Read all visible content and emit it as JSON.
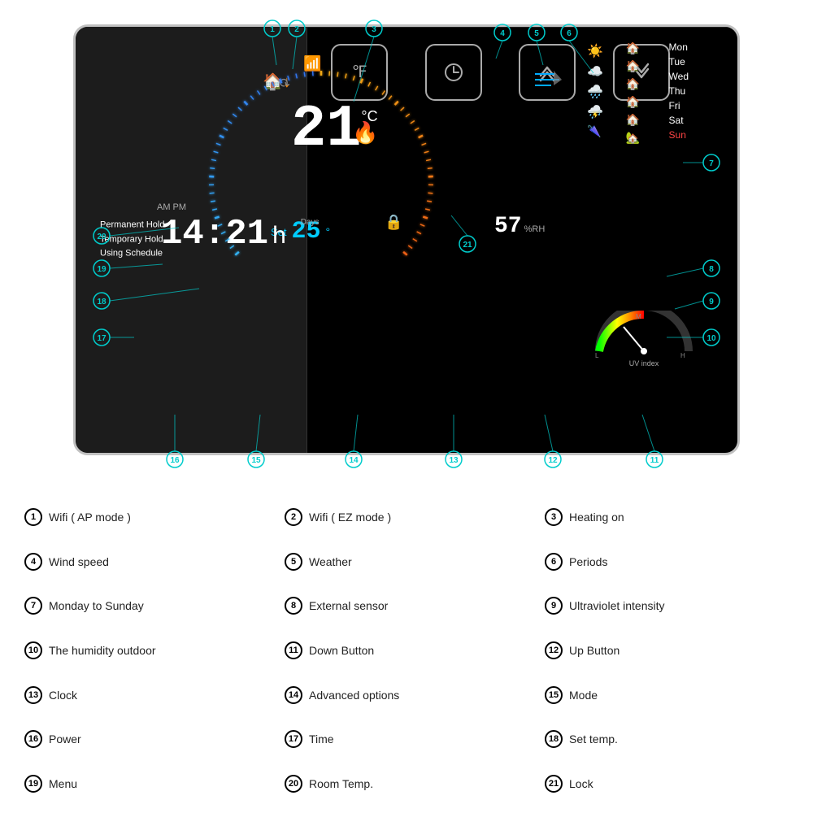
{
  "device": {
    "current_temp": "21",
    "temp_unit": "°C",
    "set_label": "Set",
    "set_temp": "25",
    "set_unit": "°",
    "time": "14:21",
    "time_suffix": "h",
    "am_pm": "AM PM",
    "days_label": "Days",
    "humidity": "57",
    "humidity_unit": "%RH",
    "uv_label": "UV index",
    "hold_modes": [
      "Permanent Hold",
      "Temporary Hold",
      "Using Schedule"
    ]
  },
  "days": [
    "Mon",
    "Tue",
    "Wed",
    "Thu",
    "Fri",
    "Sat",
    "Sun"
  ],
  "buttons": [
    {
      "id": "power",
      "symbol": "⏻",
      "label": "Power"
    },
    {
      "id": "mode",
      "symbol": "⊞",
      "label": "Mode"
    },
    {
      "id": "fahrenheit",
      "symbol": "℉",
      "label": "F/C"
    },
    {
      "id": "clock",
      "symbol": "🕐",
      "label": "Clock"
    },
    {
      "id": "up",
      "symbol": "⌃",
      "label": "Up"
    },
    {
      "id": "down",
      "symbol": "⌄",
      "label": "Down"
    }
  ],
  "annotations": [
    {
      "num": "1",
      "label": "Wifi ( AP mode )"
    },
    {
      "num": "2",
      "label": "Wifi ( EZ mode )"
    },
    {
      "num": "3",
      "label": "Heating on"
    },
    {
      "num": "4",
      "label": "Wind speed"
    },
    {
      "num": "5",
      "label": "Weather"
    },
    {
      "num": "6",
      "label": "Periods"
    },
    {
      "num": "7",
      "label": "Monday to Sunday"
    },
    {
      "num": "8",
      "label": "External sensor"
    },
    {
      "num": "9",
      "label": "Ultraviolet intensity"
    },
    {
      "num": "10",
      "label": "The humidity outdoor"
    },
    {
      "num": "11",
      "label": "Down Button"
    },
    {
      "num": "12",
      "label": "Up Button"
    },
    {
      "num": "13",
      "label": "Clock"
    },
    {
      "num": "14",
      "label": "Advanced options"
    },
    {
      "num": "15",
      "label": "Mode"
    },
    {
      "num": "16",
      "label": "Power"
    },
    {
      "num": "17",
      "label": "Time"
    },
    {
      "num": "18",
      "label": "Set temp."
    },
    {
      "num": "19",
      "label": "Menu"
    },
    {
      "num": "20",
      "label": "Room Temp."
    },
    {
      "num": "21",
      "label": "Lock"
    }
  ],
  "colors": {
    "annotation": "#00cccc",
    "accent_blue": "#00aaff",
    "accent_orange": "#ff8800",
    "text_white": "#ffffff",
    "background": "#000000"
  }
}
